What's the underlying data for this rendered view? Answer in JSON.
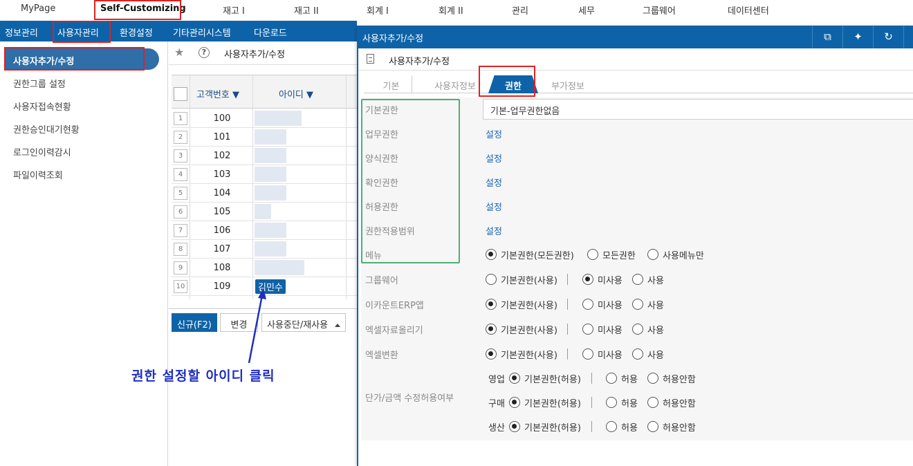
{
  "topmenu": [
    "MyPage",
    "Self-Customizing",
    "재고 I",
    "재고 II",
    "회계 I",
    "회계 II",
    "관리",
    "세무",
    "그룹웨어",
    "데이터센터"
  ],
  "submenu": [
    "정보관리",
    "사용자관리",
    "환경설정",
    "기타관리시스템",
    "다운로드"
  ],
  "sidebar": {
    "active": "사용자추가/수정",
    "items": [
      "권한그룹 설정",
      "사용자접속현황",
      "권한승인대기현황",
      "로그인이력감시",
      "파일이력조회"
    ]
  },
  "list": {
    "title": "사용자추가/수정",
    "col_customer": "고객번호",
    "col_id": "아이디",
    "rows": [
      {
        "idx": "1",
        "cust": "100"
      },
      {
        "idx": "2",
        "cust": "101"
      },
      {
        "idx": "3",
        "cust": "102"
      },
      {
        "idx": "4",
        "cust": "103"
      },
      {
        "idx": "5",
        "cust": "104"
      },
      {
        "idx": "6",
        "cust": "105"
      },
      {
        "idx": "7",
        "cust": "106"
      },
      {
        "idx": "8",
        "cust": "107"
      },
      {
        "idx": "9",
        "cust": "108"
      },
      {
        "idx": "10",
        "cust": "109",
        "id": "김민수"
      }
    ],
    "btn_new": "신규(F2)",
    "btn_change": "변경",
    "btn_stop": "사용중단/재사용"
  },
  "annotation": "권한 설정할 아이디 클릭",
  "dialog": {
    "title": "사용자추가/수정",
    "subtitle": "사용자추가/수정",
    "tabs": [
      "기본",
      "사용자정보",
      "권한",
      "부가정보"
    ],
    "basic_label": "기본권한",
    "basic_value": "기본-업무권한없음",
    "set_rows": [
      {
        "label": "업무권한",
        "link": "설정"
      },
      {
        "label": "양식권한",
        "link": "설정"
      },
      {
        "label": "확인권한",
        "link": "설정"
      },
      {
        "label": "허용권한",
        "link": "설정"
      },
      {
        "label": "권한적용범위",
        "link": "설정"
      }
    ],
    "menu": {
      "label": "메뉴",
      "opts": [
        "기본권한(모든권한)",
        "모든권한",
        "사용메뉴만"
      ]
    },
    "radio_rows": [
      {
        "label": "그룹웨어",
        "opts": [
          "기본권한(사용)",
          "미사용",
          "사용"
        ],
        "sel": 1
      },
      {
        "label": "이카운트ERP앱",
        "opts": [
          "기본권한(사용)",
          "미사용",
          "사용"
        ],
        "sel": 0
      },
      {
        "label": "엑셀자료올리기",
        "opts": [
          "기본권한(사용)",
          "미사용",
          "사용"
        ],
        "sel": 0
      },
      {
        "label": "엑셀변환",
        "opts": [
          "기본권한(사용)",
          "미사용",
          "사용"
        ],
        "sel": 0
      }
    ],
    "price": {
      "label": "단가/금액 수정허용여부",
      "rows": [
        {
          "sub": "영업",
          "opts": [
            "기본권한(허용)",
            "허용",
            "허용안함"
          ]
        },
        {
          "sub": "구매",
          "opts": [
            "기본권한(허용)",
            "허용",
            "허용안함"
          ]
        },
        {
          "sub": "생산",
          "opts": [
            "기본권한(허용)",
            "허용",
            "허용안함"
          ]
        }
      ]
    }
  }
}
